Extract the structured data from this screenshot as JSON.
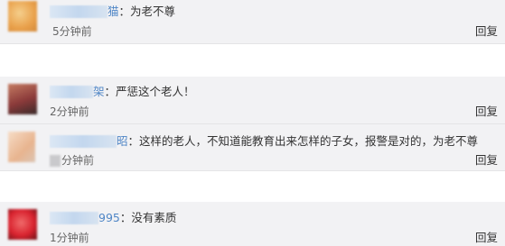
{
  "comments": [
    {
      "user_suffix": "猫",
      "text": "：为老不尊",
      "time": "5分钟前",
      "reply": "回复",
      "avatar_colors": [
        "#e9a04a",
        "#f5cf8c"
      ]
    },
    {
      "user_suffix": "架",
      "text": "：严惩这个老人！",
      "time": "2分钟前",
      "reply": "回复",
      "avatar_colors": [
        "#8b3a3a",
        "#c47b62"
      ]
    },
    {
      "user_suffix": "昭",
      "text": "：这样的老人，不知道能教育出来怎样的子女，报警是对的，为老不尊",
      "time": "分钟前",
      "reply": "回复",
      "avatar_colors": [
        "#e8b48f",
        "#f6dcc6"
      ]
    },
    {
      "user_suffix": "995",
      "text": "：没有素质",
      "time": "1分钟前",
      "reply": "回复",
      "avatar_colors": [
        "#d9232f",
        "#f06a6a"
      ]
    }
  ]
}
